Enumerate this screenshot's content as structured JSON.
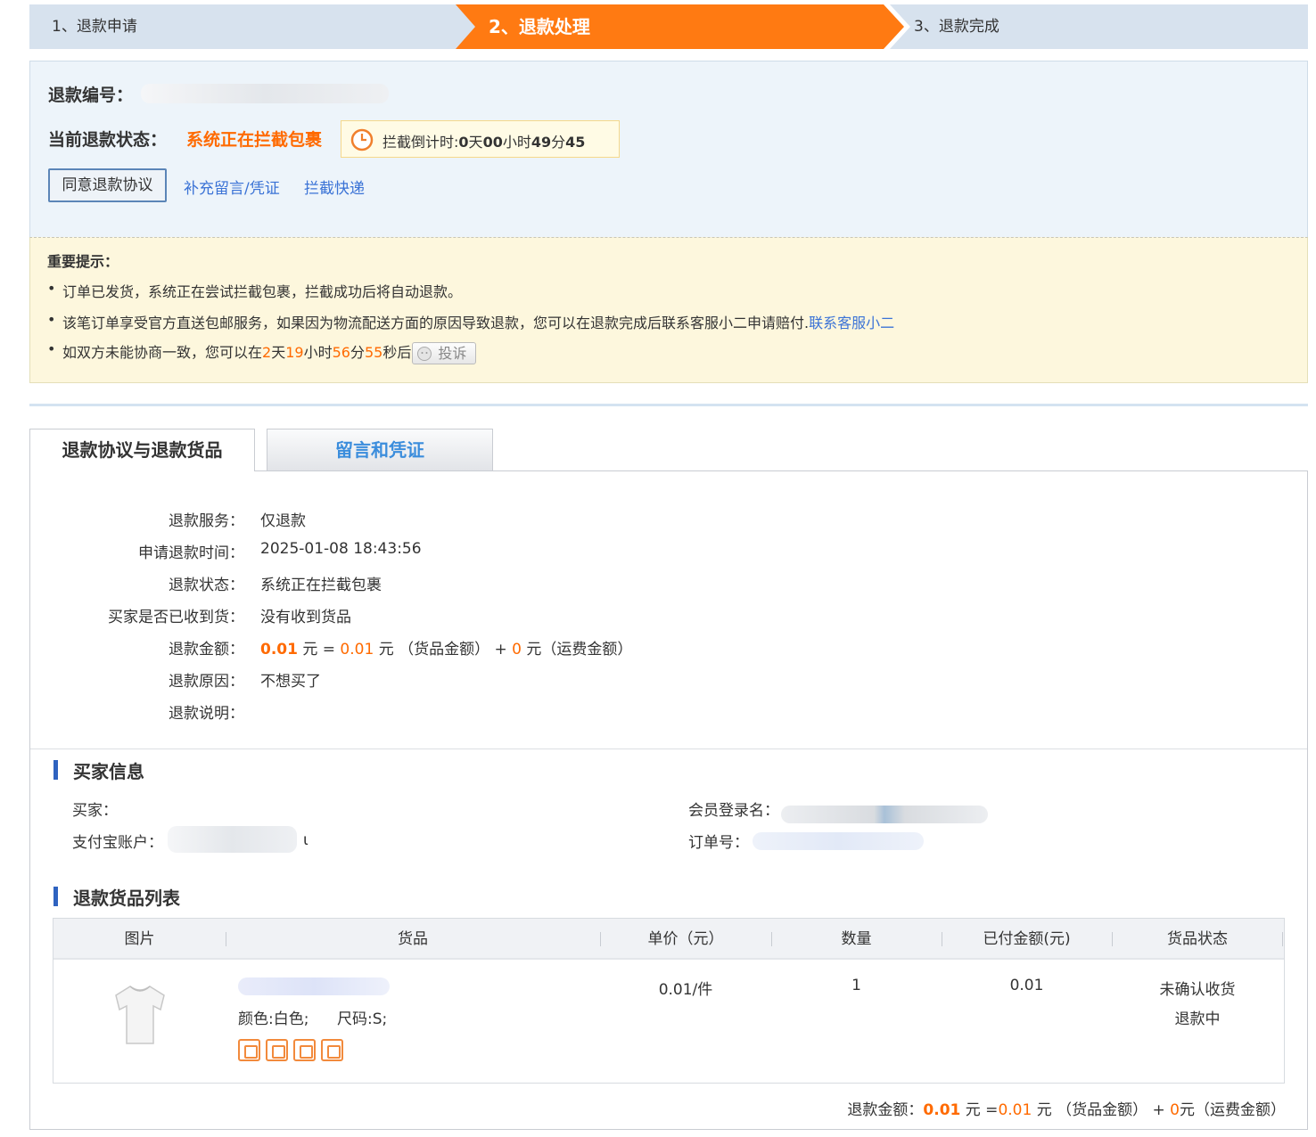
{
  "steps": {
    "step1": "1、退款申请",
    "step2": "2、退款处理",
    "step3": "3、退款完成"
  },
  "info": {
    "refund_no_label": "退款编号：",
    "status_label": "当前退款状态：",
    "status_value": "系统正在拦截包裹",
    "countdown_prefix": "拦截倒计时:",
    "countdown_days": "0",
    "countdown_day_unit": "天",
    "countdown_hours": "00",
    "countdown_hour_unit": "小时",
    "countdown_minutes": "49",
    "countdown_minute_unit": "分",
    "countdown_seconds": "45",
    "agree_button": "同意退款协议",
    "supplement_link": "补充留言/凭证",
    "intercept_link": "拦截快递"
  },
  "notice": {
    "title": "重要提示：",
    "item1": "订单已发货，系统正在尝试拦截包裹，拦截成功后将自动退款。",
    "item2": "该笔订单享受官方直送包邮服务，如果因为物流配送方面的原因导致退款，您可以在退款完成后联系客服小二申请赔付.",
    "item2_link": "联系客服小二",
    "item3_prefix": "如双方未能协商一致，您可以在",
    "item3_days": "2",
    "item3_day_unit": "天",
    "item3_hours": "19",
    "item3_hour_unit": "小时",
    "item3_minutes": "56",
    "item3_minute_unit": "分",
    "item3_seconds": "55",
    "item3_suffix": "秒后",
    "complain_button": "投诉"
  },
  "tabs": {
    "tab1": "退款协议与退款货品",
    "tab2": "留言和凭证"
  },
  "details": {
    "service_label": "退款服务：",
    "service_value": "仅退款",
    "apply_time_label": "申请退款时间：",
    "apply_time_value": "2025-01-08 18:43:56",
    "status_label": "退款状态：",
    "status_value": "系统正在拦截包裹",
    "received_label": "买家是否已收到货：",
    "received_value": "没有收到货品",
    "amount_label": "退款金额：",
    "amount_total": "0.01",
    "amount_unit_eq": "元 =",
    "amount_goods": "0.01",
    "amount_goods_text": "元 （货品金额） +",
    "amount_shipping": "0",
    "amount_shipping_text": "元（运费金额）",
    "reason_label": "退款原因：",
    "reason_value": "不想买了",
    "desc_label": "退款说明："
  },
  "buyer": {
    "section_title": "买家信息",
    "buyer_label": "买家：",
    "alipay_label": "支付宝账户：",
    "alipay_tail": "ι",
    "member_label": "会员登录名：",
    "order_label": "订单号："
  },
  "goods": {
    "section_title": "退款货品列表",
    "headers": [
      "图片",
      "货品",
      "单价（元）",
      "数量",
      "已付金额(元)",
      "货品状态"
    ],
    "spec_color": "颜色:白色;",
    "spec_size": "尺码:S;",
    "price": "0.01/件",
    "qty": "1",
    "paid": "0.01",
    "status1": "未确认收货",
    "status2": "退款中"
  },
  "total": {
    "label": "退款金额：",
    "amount": "0.01",
    "eq": "元 =",
    "goods": "0.01",
    "goods_text": "元 （货品金额） +",
    "shipping": "0",
    "shipping_text": "元（运费金额）"
  }
}
